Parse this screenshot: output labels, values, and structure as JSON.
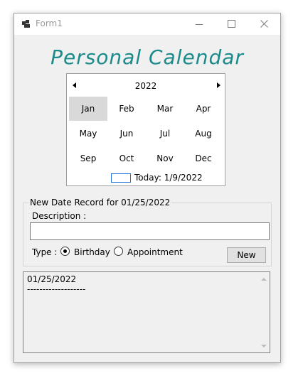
{
  "window": {
    "title": "Form1"
  },
  "heading": "Personal Calendar",
  "calendar": {
    "year": "2022",
    "months": [
      "Jan",
      "Feb",
      "Mar",
      "Apr",
      "May",
      "Jun",
      "Jul",
      "Aug",
      "Sep",
      "Oct",
      "Nov",
      "Dec"
    ],
    "selected_month": "Jan",
    "today_label": "Today: 1/9/2022"
  },
  "record": {
    "group_title": "New Date Record for 01/25/2022",
    "description_label": "Description :",
    "description_value": "",
    "type_label": "Type :",
    "options": [
      "Birthday",
      "Appointment"
    ],
    "selected_option": "Birthday",
    "new_button": "New"
  },
  "log": {
    "lines": [
      "01/25/2022",
      "-------------------"
    ]
  },
  "colors": {
    "heading": "#1a8a8a",
    "selected_month_bg": "#d9d9d9",
    "today_box": "#1e6fd9"
  },
  "icons": {
    "app": "app-window-icon",
    "minimize": "minimize-icon",
    "maximize": "maximize-icon",
    "close": "close-icon",
    "prev": "left-arrow-icon",
    "next": "right-arrow-icon"
  }
}
